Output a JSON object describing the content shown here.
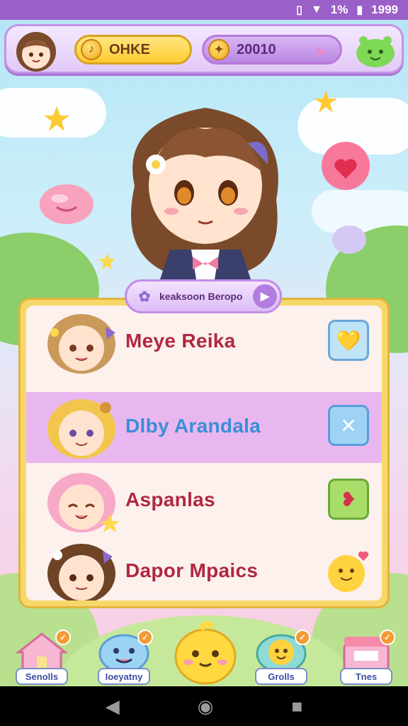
{
  "status": {
    "time": "1999",
    "battery": "1%"
  },
  "topbar": {
    "currency1": "OHKE",
    "currency2": "20010"
  },
  "banner": {
    "title": "keaksoon Beropo"
  },
  "list": [
    {
      "name": "Meye Reika",
      "action_icon": "heart-check-icon",
      "selected": false
    },
    {
      "name": "Dlby Arandala",
      "action_icon": "sparkle-x-icon",
      "selected": true
    },
    {
      "name": "Aspanlas",
      "action_icon": "gift-icon",
      "selected": false
    },
    {
      "name": "Dapor Mpaics",
      "action_icon": "smiley-heart-icon",
      "selected": false
    }
  ],
  "nav": [
    {
      "label": "Senolls",
      "icon": "house-icon",
      "badge": "✓"
    },
    {
      "label": "Ioeyatny",
      "icon": "monster-icon",
      "badge": "✓"
    },
    {
      "label": "Grolls",
      "icon": "frog-icon",
      "badge": "✓"
    },
    {
      "label": "Tnes",
      "icon": "shop-icon",
      "badge": "✓"
    }
  ],
  "colors": {
    "accent": "#b37ce0",
    "panel": "#f7d76a",
    "selected_row": "#e9b7ef"
  }
}
